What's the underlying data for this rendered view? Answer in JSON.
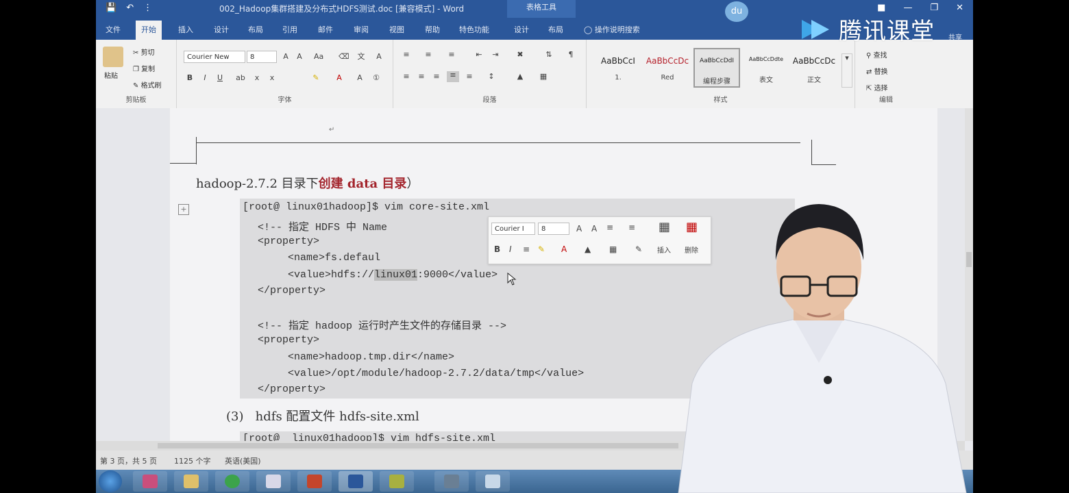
{
  "titlebar": {
    "doc_title": "002_Hadoop集群搭建及分布式HDFS测试.doc [兼容模式] - Word",
    "context_tools": "表格工具"
  },
  "tabs": [
    "文件",
    "开始",
    "插入",
    "设计",
    "布局",
    "引用",
    "邮件",
    "审阅",
    "视图",
    "帮助",
    "特色功能",
    "设计",
    "布局"
  ],
  "tell_me": "操作说明搜索",
  "ribbon": {
    "clipboard": {
      "paste": "粘贴",
      "cut": "剪切",
      "copy": "复制",
      "painter": "格式刷",
      "label": "剪贴板"
    },
    "font": {
      "name": "Courier New",
      "size": "8",
      "label": "字体"
    },
    "paragraph": {
      "label": "段落"
    },
    "styles": {
      "label": "样式",
      "items": [
        {
          "preview": "AaBbCcI",
          "name": "1."
        },
        {
          "preview": "AaBbCcDc",
          "name": "Red"
        },
        {
          "preview": "AaBbCcDdI",
          "name": "编程步骤"
        },
        {
          "preview": "AaBbCcDdte",
          "name": "表文"
        },
        {
          "preview": "AaBbCcDc",
          "name": "正文"
        }
      ]
    },
    "editing": {
      "find": "查找",
      "replace": "替换",
      "select": "选择",
      "label": "编辑"
    },
    "share": "共享"
  },
  "doc": {
    "heading_prefix": "hadoop-2.7.2 目录下",
    "heading_red": "创建 data 目录",
    "heading_suffix": "）",
    "code": [
      "[root@ linux01hadoop]$ vim core-site.xml",
      "<!-- 指定 HDFS 中 Name",
      "<property>",
      "<name>fs.defaul",
      "<value>hdfs://",
      "linux01",
      ":9000</value>",
      "</property>",
      "<!-- 指定 hadoop 运行时产生文件的存储目录 -->",
      "<property>",
      "<name>hadoop.tmp.dir</name>",
      "<value>/opt/module/hadoop-2.7.2/data/tmp</value>",
      "</property>"
    ],
    "subhead_num": "(3)",
    "subhead_text": "hdfs 配置文件  hdfs-site.xml",
    "code2": "[root@  linux01hadoop]$ vim hdfs-site.xml"
  },
  "mini_toolbar": {
    "font": "Courier I",
    "size": "8",
    "insert": "插入",
    "delete": "删除"
  },
  "status": {
    "page": "第 3 页，共 5 页",
    "words": "1125 个字",
    "lang": "英语(美国)"
  },
  "watermark": "腾讯课堂",
  "cloud": "du",
  "colors": {
    "word_blue": "#2b579a",
    "heading_red": "#a3242c"
  }
}
